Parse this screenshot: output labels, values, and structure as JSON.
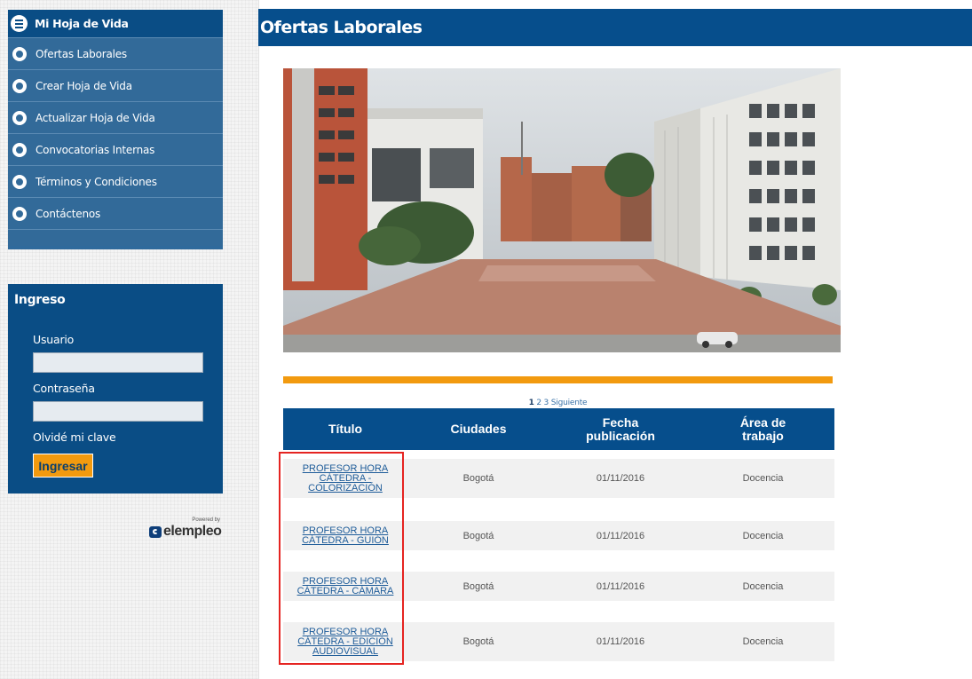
{
  "sidebar": {
    "menu_title": "Mi Hoja de Vida",
    "items": [
      {
        "label": "Ofertas Laborales"
      },
      {
        "label": "Crear Hoja de Vida"
      },
      {
        "label": "Actualizar Hoja de Vida"
      },
      {
        "label": "Convocatorias Internas"
      },
      {
        "label": "Términos y Condiciones"
      },
      {
        "label": "Contáctenos"
      }
    ]
  },
  "login": {
    "title": "Ingreso",
    "user_label": "Usuario",
    "password_label": "Contraseña",
    "forgot_label": "Olvidé mi clave",
    "submit_label": "Ingresar"
  },
  "powered": {
    "text": "Powered by",
    "brand": "elempleo"
  },
  "main": {
    "title": "Ofertas Laborales"
  },
  "pagination": {
    "current": "1",
    "pages": [
      "2",
      "3"
    ],
    "next_label": "Siguiente"
  },
  "table": {
    "headers": [
      "Título",
      "Ciudades",
      "Fecha publicación",
      "Área de trabajo"
    ],
    "rows": [
      {
        "title": "PROFESOR HORA CÁTEDRA - COLORIZACIÓN",
        "city": "Bogotá",
        "date": "01/11/2016",
        "area": "Docencia"
      },
      {
        "title": "PROFESOR HORA CÁTEDRA - GUIÓN",
        "city": "Bogotá",
        "date": "01/11/2016",
        "area": "Docencia"
      },
      {
        "title": "PROFESOR HORA CÁTEDRA - CÁMARA",
        "city": "Bogotá",
        "date": "01/11/2016",
        "area": "Docencia"
      },
      {
        "title": "PROFESOR HORA CÁTEDRA - EDICIÓN AUDIOVISUAL",
        "city": "Bogotá",
        "date": "01/11/2016",
        "area": "Docencia"
      }
    ]
  },
  "colors": {
    "primary_blue": "#064e8c",
    "menu_blue": "#326a99",
    "accent_orange": "#f29a0f",
    "highlight_red": "#e52421"
  }
}
